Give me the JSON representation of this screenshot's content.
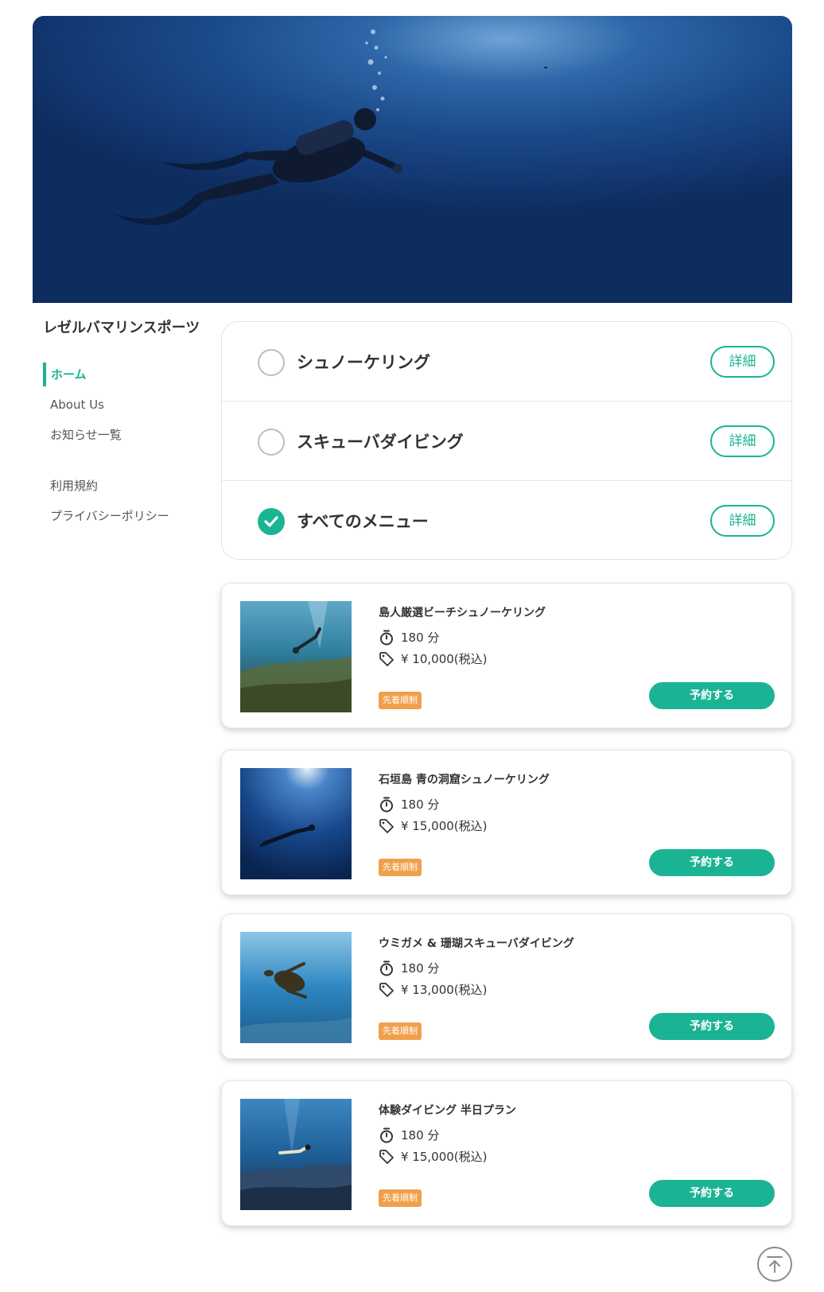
{
  "brand": {
    "name": "レゼルバマリンスポーツ"
  },
  "hero": {
    "image": "scuba-diver-underwater-photo"
  },
  "nav": {
    "items": [
      {
        "label": "ホーム",
        "active": true
      },
      {
        "label": "About Us"
      },
      {
        "label": "お知らせ一覧"
      },
      {
        "label": "利用規約"
      },
      {
        "label": "プライバシーポリシー"
      }
    ]
  },
  "filters": [
    {
      "label": "シュノーケリング",
      "checked": false,
      "detail_label": "詳細"
    },
    {
      "label": "スキューバダイビング",
      "checked": false,
      "detail_label": "詳細"
    },
    {
      "label": "すべてのメニュー",
      "checked": true,
      "detail_label": "詳細"
    }
  ],
  "cards": [
    {
      "title": "島人厳選ビーチシュノーケリング",
      "duration": "180 分",
      "price": "¥ 10,000(税込)",
      "badge": "先着順制",
      "button": "予約する",
      "image": "snorkeler-reef-photo"
    },
    {
      "title": "石垣島 青の洞窟シュノーケリング",
      "duration": "180 分",
      "price": "¥ 15,000(税込)",
      "badge": "先着順制",
      "button": "予約する",
      "image": "diver-deep-blue-photo"
    },
    {
      "title": "ウミガメ & 珊瑚スキューバダイビング",
      "duration": "180 分",
      "price": "¥ 13,000(税込)",
      "badge": "先着順制",
      "button": "予約する",
      "image": "sea-turtle-photo"
    },
    {
      "title": "体験ダイビング 半日プラン",
      "duration": "180 分",
      "price": "¥ 15,000(税込)",
      "badge": "先着順制",
      "button": "予約する",
      "image": "diver-coral-photo"
    }
  ],
  "colors": {
    "accent": "#1ab394",
    "badge": "#f0a04b",
    "text": "#333333"
  },
  "icons": {
    "timer": "stopwatch-icon",
    "price": "price-tag-icon",
    "check": "check-icon",
    "scroll_top": "arrow-up-icon"
  }
}
